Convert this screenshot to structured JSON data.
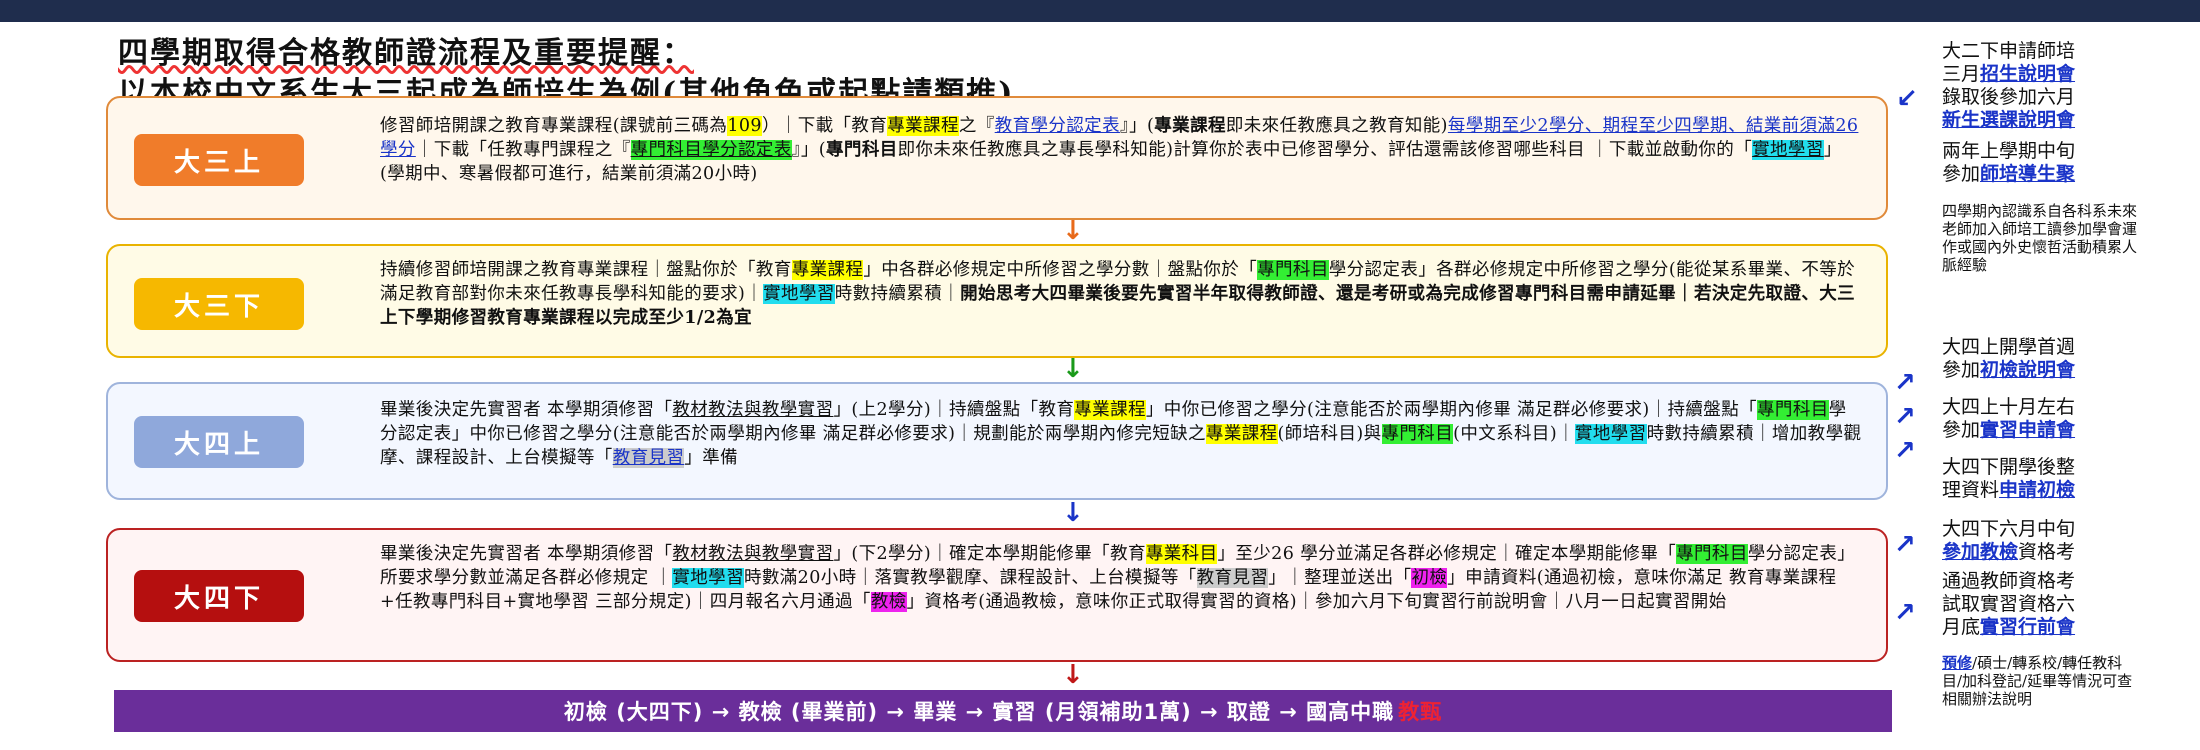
{
  "title": {
    "line1": "四學期取得合格教師證流程及重要提醒：",
    "line2": "以本校中文系生大三起成為師培生為例(其他角色或起點請類推)"
  },
  "stages": [
    {
      "label": "大三上"
    },
    {
      "label": "大三下"
    },
    {
      "label": "大四上"
    },
    {
      "label": "大四下"
    }
  ],
  "s1": {
    "t1": "修習師培開課之教育專業課程(課號前三碼為",
    "t2": "109",
    "t3": "）｜下載「教育",
    "t4": "專業課程",
    "t5": "之『",
    "t6": "教育學分認定表",
    "t7": "』」(",
    "t8": "專業課程",
    "t9": "即未來任教應具之教育知能)",
    "t10": "每學期至少2學分、期程至少四學期、結業前須滿26學分",
    "t11": "｜下載「任教專門課程之『",
    "t12": "專門科目學分認定表",
    "t13": "』」(",
    "t14": "專門科目",
    "t15": "即你未來任教應具之專長學科知能)計算你於表中已修習學分、評估還需該修習哪些科目 ｜下載並啟動你的「",
    "t16": "實地學習",
    "t17": "」(學期中、寒暑假都可進行，結業前須滿20小時)"
  },
  "s2": {
    "t1": "持續修習師培開課之教育專業課程｜盤點你於「教育",
    "t2": "專業課程",
    "t3": "」中各群必修規定中所修習之學分數｜盤點你於「",
    "t4": "專門科目",
    "t5": "學分認定表」各群必修規定中所修習之學分(能從某系畢業、不等於滿足教育部對你未來任教專長學科知能的要求)｜",
    "t6": "實地學習",
    "t7": "時數持續累積｜",
    "t8": "開始思考大四畢業後要先實習半年取得教師證、還是考研或為完成修習專門科目需申請延畢｜若決定先取證、大三上下學期修習教育專業課程以完成至少1/2為宜"
  },
  "s3": {
    "t1": "畢業後決定先實習者 本學期須修習「",
    "t2": "教材教法與教學實習",
    "t3": "」(上2學分)｜持續盤點「教育",
    "t4": "專業課程",
    "t5": "」中你已修習之學分(注意能否於兩學期內修畢 滿足群必修要求)｜持續盤點「",
    "t6": "專門科目",
    "t7": "學分認定表」中你已修習之學分(注意能否於兩學期內修畢 滿足群必修要求)｜規劃能於兩學期內修完短缺之",
    "t8": "專業課程",
    "t9": "(師培科目)與",
    "t10": "專門科目",
    "t11": "(中文系科目)｜",
    "t12": "實地學習",
    "t13": "時數持續累積｜增加教學觀摩、課程設計、上台模擬等「",
    "t14": "教育見習",
    "t15": "」準備"
  },
  "s4": {
    "t1": "畢業後決定先實習者 本學期須修習「",
    "t2": "教材教法與教學實習",
    "t3": "」(下2學分)｜確定本學期能修畢「教育",
    "t4": "專業科目",
    "t5": "」至少26 學分並滿足各群必修規定｜確定本學期能修畢「",
    "t6": "專門科目",
    "t7": "學分認定表」所要求學分數並滿足各群必修規定 ｜",
    "t8": "實地學習",
    "t9": "時數滿20小時｜落實教學觀摩、課程設計、上台模擬等「",
    "t10": "教育見習",
    "t11": "」｜整理並送出「",
    "t12": "初檢",
    "t13": "」申請資料(通過初檢，意味你滿足 教育專業課程+任教專門科目+實地學習 三部分規定)｜四月報名六月通過「",
    "t14": "教檢",
    "t15": "」資格考(通過教檢，意味你正式取得實習的資格)｜參加六月下旬實習行前說明會｜八月一日起實習開始"
  },
  "flow": {
    "text": "初檢 (大四下) → 教檢 (畢業前) → 畢業 → 實習 (月領補助1萬) → 取證 → 國高中職",
    "highlight": "教甄"
  },
  "side": {
    "n1a": "大二下申請師培",
    "n1b": "三月",
    "n1c": "招生說明會",
    "n1d": "錄取後參加六月",
    "n1e": "新生選課說明會",
    "n2a": "兩年上學期中旬",
    "n2b": "參加",
    "n2c": "師培導生聚",
    "n3": "四學期內認識系自各科系未來老師加入師培工讀參加學會運作或國內外史懷哲活動積累人脈經驗",
    "n4a": "大四上開學首週",
    "n4b": "參加",
    "n4c": "初檢說明會",
    "n5a": "大四上十月左右",
    "n5b": "參加",
    "n5c": "實習申請會",
    "n6a": "大四下開學後整",
    "n6b": "理資料",
    "n6c": "申請初檢",
    "n7a": "大四下六月中旬",
    "n7b": "參加教檢",
    "n7c": "資格考",
    "n8a": "通過教師資格考",
    "n8b": "試取實習資格六",
    "n8c": "月底",
    "n8d": "實習行前會",
    "n9a": "預修",
    "n9b": "/碩士/轉系校/轉任教科目/加科登記/延畢等情況可查相關辦法說明"
  }
}
